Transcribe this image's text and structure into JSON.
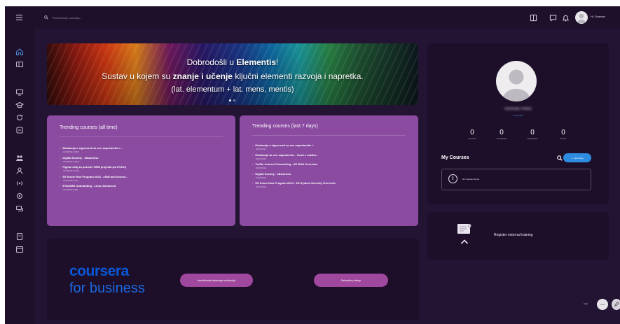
{
  "topbar": {
    "search_placeholder": "Pretraživanje sadržaja...",
    "user_name": "Hi, Somiran"
  },
  "banner": {
    "line1_prefix": "Dobrodošli u ",
    "line1_brand": "Elementis",
    "line1_suffix": "!",
    "line2_prefix": "Sustav u kojem su ",
    "line2_bold": "znanje i učenje",
    "line2_suffix": " ključni elementi razvoja i napretka.",
    "line3": "(lat. elementum + lat. mens, mentis)"
  },
  "trending_all": {
    "title": "Trending courses (all time)",
    "items": [
      {
        "title": "Edukacija o sigurnosti za ove zaposlenike i...",
        "date": "01/08/2024 (350)"
      },
      {
        "title": "Digital Society - eBusiness",
        "date": "27/06/2024 (308)"
      },
      {
        "title": "Figma tečaj za potrebe HRM projekta (za ETA/C)",
        "date": "12/08/2024 (116)"
      },
      {
        "title": "5G Know How Program 2024 - eSIM and Secure...",
        "date": "21/06/2024 (73)"
      },
      {
        "title": "ETA/DMD Onboarding - Linux Advanced",
        "date": "01/08/2024 (55)"
      }
    ]
  },
  "trending_week": {
    "title": "Trending courses (last 7 days)",
    "items": [
      {
        "title": "Edukacija o sigurnosti za ove zaposlenike i...",
        "date": "02/08/2024"
      },
      {
        "title": "Edukacija za ove zaposlenike - Uvod u zaštitu...",
        "date": "02/07/2024"
      },
      {
        "title": "Traffic Control Onboarding - 5G RAN Overview",
        "date": "24/08/2024"
      },
      {
        "title": "Digital Society - eBusiness",
        "date": "27/06/2024"
      },
      {
        "title": "5G Know How Program 2024 - 5G System Security Overview",
        "date": "01/07/2024"
      }
    ]
  },
  "coursera": {
    "logo_line1": "coursera",
    "logo_line2": "for business",
    "button_catalog": "Istraživanje kataloga edukacija",
    "button_request": "Zatražite pristup"
  },
  "profile": {
    "name": "Somiran Petrić",
    "email": "edit profile",
    "stats": [
      {
        "value": "0",
        "label": "Courses"
      },
      {
        "value": "0",
        "label": "Completed"
      },
      {
        "value": "0",
        "label": "Certificates"
      },
      {
        "value": "0",
        "label": "Points"
      }
    ],
    "my_courses_title": "My Courses",
    "upcoming_label": "Upcoming",
    "no_courses": "No Courses found"
  },
  "external": {
    "label": "Register external training"
  },
  "floating": {
    "label": "Help",
    "chat_label": "chat"
  },
  "colors": {
    "app_bg": "#241433",
    "card_purple": "#8a4ba1",
    "accent_blue": "#2e8ce0",
    "pill_pink": "#a0479e",
    "coursera_blue": "#0a58d8"
  }
}
